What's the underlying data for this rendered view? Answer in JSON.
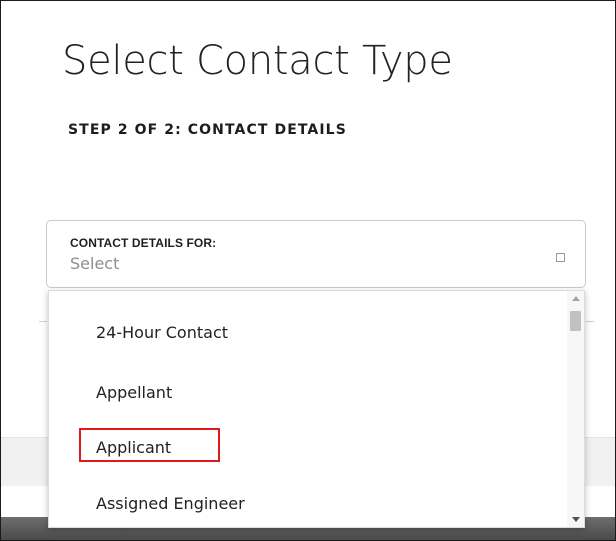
{
  "dialog": {
    "title": "Select Contact Type",
    "step_label": "STEP 2 OF 2: CONTACT DETAILS"
  },
  "contact_select": {
    "label": "CONTACT DETAILS FOR:",
    "value": "Select",
    "icon": "chevron-down-icon"
  },
  "dropdown": {
    "options": [
      {
        "label": "24-Hour Contact"
      },
      {
        "label": "Appellant"
      },
      {
        "label": "Applicant",
        "highlighted": true
      },
      {
        "label": "Assigned Engineer"
      }
    ],
    "highlight_color": "#e0191b"
  }
}
